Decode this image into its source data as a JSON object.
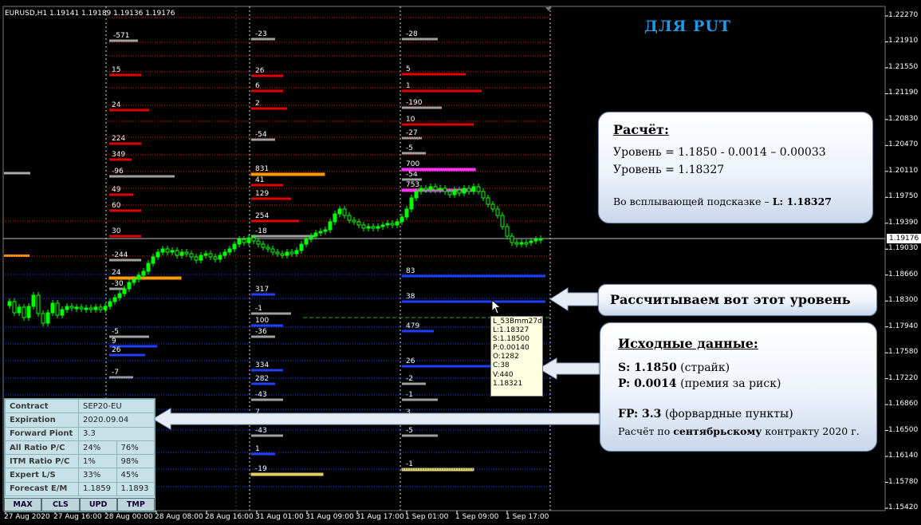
{
  "symbol_header": "EURUSD,H1  1.19141 1.19189 1.19136 1.19176",
  "title": "ДЛЯ PUT",
  "calc": {
    "heading": "Расчёт:",
    "line1": "Уровень  =  1.1850 - 0.0014 – 0.00033",
    "line2": "Уровень  =  1.18327",
    "line3_prefix": "Во всплывающей подсказке – ",
    "line3_value": "L: 1.18327"
  },
  "level_label": "Рассчитываем вот  этот  уровень",
  "source": {
    "heading": "Исходные данные:",
    "s_label": "S: 1.1850",
    "s_note": " (страйк)",
    "p_label": "P: 0.0014",
    "p_note": " (премия за риск)",
    "fp_label": "FP: 3.3",
    "fp_note": " (форвардные пункты)",
    "contract_prefix": "Расчёт по ",
    "contract_bold": "сентябрьскому",
    "contract_suffix": " контракту 2020 г."
  },
  "tooltip": [
    "L_53Bmm27d",
    "L:1.18327",
    "S:1.18500",
    "P:0.00140",
    "O:1282",
    "C:38",
    "V:440",
    "1.18321"
  ],
  "info_panel": {
    "rows": [
      {
        "k": "Contract",
        "v1": "SEP20-EU",
        "v2": ""
      },
      {
        "k": "Expiration",
        "v1": "2020.09.04",
        "v2": ""
      },
      {
        "k": "Forward Piont",
        "v1": "3.3",
        "v2": ""
      },
      {
        "k": "All Ratio P/C",
        "v1": "24%",
        "v2": "76%"
      },
      {
        "k": "ITM Ratio P/C",
        "v1": "1%",
        "v2": "98%"
      },
      {
        "k": "Expert L/S",
        "v1": "33%",
        "v2": "45%"
      },
      {
        "k": "Forecast E/M",
        "v1": "1.1859",
        "v2": "1.1893"
      }
    ],
    "buttons": [
      "MAX",
      "CLS",
      "UPD",
      "TMP"
    ]
  },
  "current_price": "1.19176",
  "y_ticks": [
    "1.22270",
    "1.21910",
    "1.21550",
    "1.21190",
    "1.20830",
    "1.20470",
    "1.20110",
    "1.19750",
    "1.19390",
    "1.19030",
    "1.18660",
    "1.18300",
    "1.17940",
    "1.17580",
    "1.17220",
    "1.16860",
    "1.16500",
    "1.16140",
    "1.15780",
    "1.15420"
  ],
  "x_ticks": [
    "27 Aug 2020",
    "27 Aug 16:00",
    "28 Aug 00:00",
    "28 Aug 08:00",
    "28 Aug 16:00",
    "31 Aug 01:00",
    "31 Aug 09:00",
    "31 Aug 17:00",
    "1 Sep 01:00",
    "1 Sep 09:00",
    "1 Sep 17:00"
  ],
  "colors": {
    "bull": "#00ff00",
    "bear": "#ffffff",
    "put": "#e00000",
    "call": "#1f3fff",
    "neutral": "#a0a0a0"
  },
  "level_groups": [
    {
      "labels": [
        {
          "t": "-571",
          "c": "neutral"
        },
        {
          "t": "15",
          "c": "put"
        },
        {
          "t": "24",
          "c": "put"
        },
        {
          "t": "224",
          "c": "put"
        },
        {
          "t": "349",
          "c": "put"
        },
        {
          "t": "-96",
          "c": "neutral"
        },
        {
          "t": "49",
          "c": "put"
        },
        {
          "t": "60",
          "c": "put"
        },
        {
          "t": "30",
          "c": "put"
        },
        {
          "t": "-244",
          "c": "neutral"
        },
        {
          "t": "24",
          "c": "orange"
        },
        {
          "t": "-30",
          "c": "neutral"
        },
        {
          "t": "-5",
          "c": "neutral"
        },
        {
          "t": "9",
          "c": "call"
        },
        {
          "t": "26",
          "c": "call"
        },
        {
          "t": "-7",
          "c": "neutral"
        }
      ]
    },
    {
      "labels": [
        {
          "t": "-23",
          "c": "neutral"
        },
        {
          "t": "26",
          "c": "put"
        },
        {
          "t": "6",
          "c": "put"
        },
        {
          "t": "2",
          "c": "put"
        },
        {
          "t": "-54",
          "c": "neutral"
        },
        {
          "t": "831",
          "c": "orange"
        },
        {
          "t": "41",
          "c": "put"
        },
        {
          "t": "129",
          "c": "put"
        },
        {
          "t": "254",
          "c": "put"
        },
        {
          "t": "-18",
          "c": "neutral"
        },
        {
          "t": "317",
          "c": "call"
        },
        {
          "t": "-1",
          "c": "neutral"
        },
        {
          "t": "100",
          "c": "call"
        },
        {
          "t": "-36",
          "c": "neutral"
        },
        {
          "t": "334",
          "c": "call"
        },
        {
          "t": "282",
          "c": "call"
        },
        {
          "t": "-43",
          "c": "neutral"
        },
        {
          "t": "7",
          "c": "call"
        },
        {
          "t": "-43",
          "c": "neutral"
        },
        {
          "t": "1",
          "c": "call"
        },
        {
          "t": "-19",
          "c": "yellow"
        }
      ]
    },
    {
      "labels": [
        {
          "t": "-28",
          "c": "neutral"
        },
        {
          "t": "5",
          "c": "put"
        },
        {
          "t": "1",
          "c": "put"
        },
        {
          "t": "-190",
          "c": "neutral"
        },
        {
          "t": "10",
          "c": "put"
        },
        {
          "t": "-27",
          "c": "neutral"
        },
        {
          "t": "-5",
          "c": "neutral"
        },
        {
          "t": "700",
          "c": "magenta"
        },
        {
          "t": "-54",
          "c": "neutral"
        },
        {
          "t": "753",
          "c": "magenta"
        },
        {
          "t": "83",
          "c": "call"
        },
        {
          "t": "38",
          "c": "call"
        },
        {
          "t": "479",
          "c": "call"
        },
        {
          "t": "26",
          "c": "call"
        },
        {
          "t": "-2",
          "c": "neutral"
        },
        {
          "t": "-1",
          "c": "neutral"
        },
        {
          "t": "3",
          "c": "call"
        },
        {
          "t": "-5",
          "c": "neutral"
        },
        {
          "t": "-1",
          "c": "yellow"
        }
      ]
    }
  ]
}
